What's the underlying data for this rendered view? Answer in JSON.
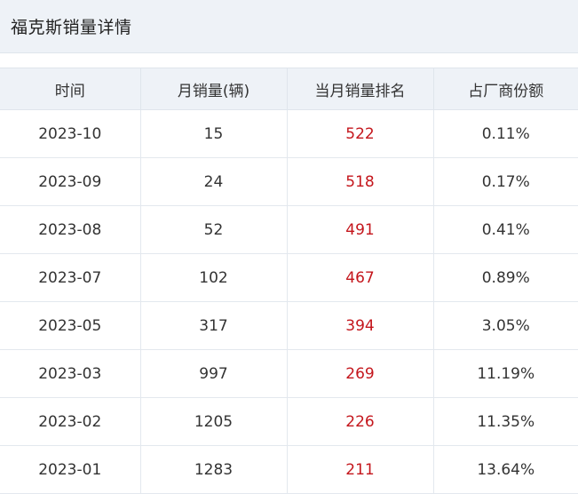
{
  "panel": {
    "title": "福克斯销量详情"
  },
  "table": {
    "headers": [
      "时间",
      "月销量(辆)",
      "当月销量排名",
      "占厂商份额"
    ],
    "rows": [
      {
        "month": "2023-10",
        "sales": "15",
        "rank": "522",
        "share": "0.11%"
      },
      {
        "month": "2023-09",
        "sales": "24",
        "rank": "518",
        "share": "0.17%"
      },
      {
        "month": "2023-08",
        "sales": "52",
        "rank": "491",
        "share": "0.41%"
      },
      {
        "month": "2023-07",
        "sales": "102",
        "rank": "467",
        "share": "0.89%"
      },
      {
        "month": "2023-05",
        "sales": "317",
        "rank": "394",
        "share": "3.05%"
      },
      {
        "month": "2023-03",
        "sales": "997",
        "rank": "269",
        "share": "11.19%"
      },
      {
        "month": "2023-02",
        "sales": "1205",
        "rank": "226",
        "share": "11.35%"
      },
      {
        "month": "2023-01",
        "sales": "1283",
        "rank": "211",
        "share": "13.64%"
      }
    ]
  },
  "colors": {
    "header_bg": "#eef2f7",
    "rank_text": "#c4161c",
    "grid_line": "#e3e8ee"
  }
}
